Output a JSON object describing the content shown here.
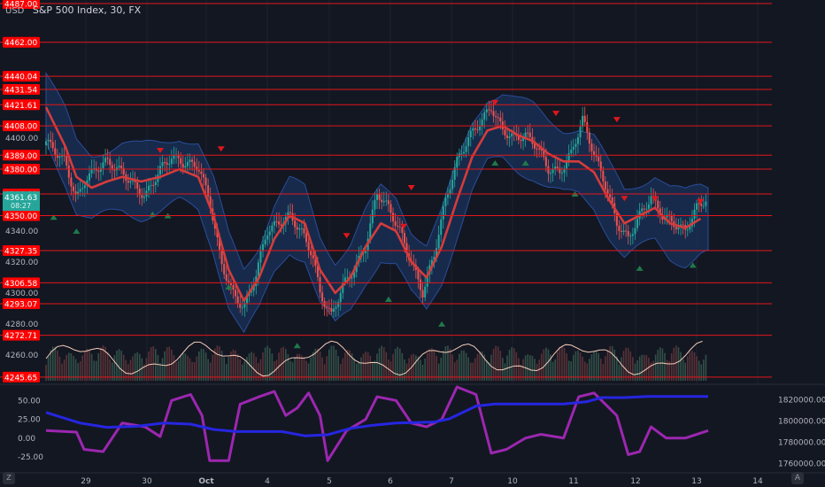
{
  "header": {
    "currency": "USD",
    "title": "S&P 500 Index, 30, FX"
  },
  "badges": {
    "last_price": "4361.63",
    "countdown": "08:27",
    "zoom": "Z",
    "auto": "A"
  },
  "colors": {
    "background": "#131722",
    "level_line": "#e3171b",
    "badge": "#ff0000",
    "last_price_badge": "#26a69a",
    "candle_up": "#26a69a",
    "candle_down": "#ef5350",
    "band_fill": "#1b3a6e",
    "basis_line": "#d43c3c",
    "volume_line": "#f3c9b8",
    "oscillator": "#9c27b0",
    "ad_line": "#2626e0"
  },
  "chart_data": [
    {
      "type": "line",
      "name": "price-panel",
      "x": [
        "29",
        "30",
        "Oct",
        "4",
        "5",
        "6",
        "7",
        "10",
        "11",
        "12",
        "13",
        "14"
      ],
      "ylim": [
        4245,
        4487
      ],
      "y_ticks": [
        4260,
        4280,
        4300,
        4320,
        4340,
        4400,
        4420
      ],
      "y_tick_labels": [
        "4260.00",
        "4280.00",
        "4300.00",
        "4320.00",
        "4340.00",
        "4400.00",
        "4420.00"
      ],
      "levels": [
        4487.0,
        4462.0,
        4440.04,
        4431.54,
        4421.61,
        4408.0,
        4389.0,
        4380.0,
        4364.0,
        4350.0,
        4327.35,
        4306.58,
        4293.07,
        4272.71,
        4245.65
      ],
      "level_labels": [
        "4487.00",
        "4462.00",
        "4440.04",
        "4431.54",
        "4421.61",
        "4408.00",
        "4389.00",
        "4380.00",
        "4364.00",
        "4350.00",
        "4327.35",
        "4306.58",
        "4293.07",
        "4272.71",
        "4245.65"
      ],
      "close_path": [
        [
          0,
          4398
        ],
        [
          0.5,
          4385
        ],
        [
          0.8,
          4360
        ],
        [
          1.0,
          4372
        ],
        [
          1.3,
          4380
        ],
        [
          1.6,
          4385
        ],
        [
          2.0,
          4378
        ],
        [
          2.3,
          4370
        ],
        [
          2.6,
          4362
        ],
        [
          3.0,
          4380
        ],
        [
          3.3,
          4388
        ],
        [
          3.6,
          4384
        ],
        [
          4.0,
          4382
        ],
        [
          4.3,
          4360
        ],
        [
          4.6,
          4320
        ],
        [
          4.9,
          4300
        ],
        [
          5.2,
          4290
        ],
        [
          5.5,
          4310
        ],
        [
          5.8,
          4340
        ],
        [
          6.1,
          4345
        ],
        [
          6.4,
          4350
        ],
        [
          6.7,
          4340
        ],
        [
          7.0,
          4325
        ],
        [
          7.2,
          4300
        ],
        [
          7.5,
          4285
        ],
        [
          7.8,
          4305
        ],
        [
          8.1,
          4315
        ],
        [
          8.4,
          4330
        ],
        [
          8.7,
          4365
        ],
        [
          9.0,
          4355
        ],
        [
          9.3,
          4340
        ],
        [
          9.6,
          4320
        ],
        [
          9.9,
          4300
        ],
        [
          10.2,
          4325
        ],
        [
          10.5,
          4360
        ],
        [
          10.8,
          4385
        ],
        [
          11.1,
          4400
        ],
        [
          11.4,
          4410
        ],
        [
          11.7,
          4420
        ],
        [
          12.0,
          4405
        ],
        [
          12.3,
          4400
        ],
        [
          12.6,
          4402
        ],
        [
          12.9,
          4395
        ],
        [
          13.2,
          4380
        ],
        [
          13.5,
          4378
        ],
        [
          13.8,
          4390
        ],
        [
          14.1,
          4412
        ],
        [
          14.4,
          4390
        ],
        [
          14.7,
          4370
        ],
        [
          15.0,
          4345
        ],
        [
          15.3,
          4335
        ],
        [
          15.6,
          4350
        ],
        [
          15.9,
          4362
        ],
        [
          16.2,
          4350
        ],
        [
          16.5,
          4345
        ],
        [
          16.8,
          4340
        ],
        [
          17.1,
          4355
        ],
        [
          17.4,
          4362
        ]
      ],
      "basis_path": [
        [
          0,
          4420
        ],
        [
          0.5,
          4395
        ],
        [
          0.8,
          4375
        ],
        [
          1.2,
          4368
        ],
        [
          1.6,
          4372
        ],
        [
          2.0,
          4375
        ],
        [
          2.5,
          4372
        ],
        [
          3.0,
          4375
        ],
        [
          3.5,
          4380
        ],
        [
          4.0,
          4375
        ],
        [
          4.4,
          4350
        ],
        [
          4.8,
          4315
        ],
        [
          5.2,
          4295
        ],
        [
          5.6,
          4310
        ],
        [
          6.0,
          4335
        ],
        [
          6.4,
          4350
        ],
        [
          6.8,
          4345
        ],
        [
          7.2,
          4315
        ],
        [
          7.6,
          4300
        ],
        [
          8.0,
          4310
        ],
        [
          8.4,
          4330
        ],
        [
          8.8,
          4345
        ],
        [
          9.2,
          4340
        ],
        [
          9.6,
          4320
        ],
        [
          10.0,
          4310
        ],
        [
          10.4,
          4330
        ],
        [
          10.8,
          4360
        ],
        [
          11.2,
          4388
        ],
        [
          11.6,
          4405
        ],
        [
          12.0,
          4408
        ],
        [
          12.4,
          4402
        ],
        [
          12.8,
          4398
        ],
        [
          13.2,
          4390
        ],
        [
          13.6,
          4385
        ],
        [
          14.0,
          4385
        ],
        [
          14.4,
          4378
        ],
        [
          14.8,
          4360
        ],
        [
          15.2,
          4345
        ],
        [
          15.6,
          4350
        ],
        [
          16.0,
          4355
        ],
        [
          16.4,
          4345
        ],
        [
          16.8,
          4342
        ],
        [
          17.2,
          4348
        ]
      ],
      "band_width": 22
    },
    {
      "type": "line",
      "name": "oscillator-panel",
      "ylim": [
        -45,
        68
      ],
      "y_ticks": [
        50,
        25,
        0,
        -25
      ],
      "y_tick_labels": [
        "50.00",
        "25.00",
        "0.00",
        "-25.00"
      ],
      "right_ylim": [
        1752000,
        1832000
      ],
      "right_ticks": [
        1820000,
        1800000,
        1780000,
        1760000
      ],
      "right_tick_labels": [
        "1820000.00",
        "1800000.00",
        "1780000.00",
        "1760000.00"
      ],
      "series": [
        {
          "points": [
            [
              0,
              10
            ],
            [
              0.8,
              8
            ],
            [
              1.0,
              -15
            ],
            [
              1.5,
              -18
            ],
            [
              2.0,
              20
            ],
            [
              2.6,
              15
            ],
            [
              3.0,
              2
            ],
            [
              3.3,
              50
            ],
            [
              3.8,
              58
            ],
            [
              4.1,
              30
            ],
            [
              4.3,
              -30
            ],
            [
              4.8,
              -30
            ],
            [
              5.1,
              45
            ],
            [
              5.6,
              55
            ],
            [
              6.0,
              62
            ],
            [
              6.3,
              30
            ],
            [
              6.6,
              40
            ],
            [
              6.9,
              60
            ],
            [
              7.2,
              30
            ],
            [
              7.4,
              -30
            ],
            [
              7.9,
              10
            ],
            [
              8.4,
              25
            ],
            [
              8.7,
              55
            ],
            [
              9.2,
              50
            ],
            [
              9.6,
              20
            ],
            [
              10.0,
              15
            ],
            [
              10.4,
              25
            ],
            [
              10.8,
              68
            ],
            [
              11.3,
              58
            ],
            [
              11.7,
              -20
            ],
            [
              12.1,
              -15
            ],
            [
              12.6,
              0
            ],
            [
              13.0,
              5
            ],
            [
              13.6,
              0
            ],
            [
              14.0,
              55
            ],
            [
              14.4,
              60
            ],
            [
              15.0,
              30
            ],
            [
              15.3,
              -22
            ],
            [
              15.6,
              -18
            ],
            [
              15.9,
              15
            ],
            [
              16.3,
              0
            ],
            [
              16.8,
              0
            ],
            [
              17.4,
              10
            ]
          ]
        },
        {
          "points": [
            [
              0,
              1808000
            ],
            [
              0.9,
              1798000
            ],
            [
              1.6,
              1794000
            ],
            [
              2.4,
              1795000
            ],
            [
              3.1,
              1798000
            ],
            [
              3.8,
              1797000
            ],
            [
              4.4,
              1792000
            ],
            [
              5.0,
              1790000
            ],
            [
              5.6,
              1790000
            ],
            [
              6.2,
              1790000
            ],
            [
              6.8,
              1786000
            ],
            [
              7.4,
              1787000
            ],
            [
              8.0,
              1793000
            ],
            [
              8.6,
              1796000
            ],
            [
              9.2,
              1798000
            ],
            [
              10.2,
              1799000
            ],
            [
              10.6,
              1802000
            ],
            [
              11.3,
              1814000
            ],
            [
              11.8,
              1816000
            ],
            [
              12.6,
              1816000
            ],
            [
              13.6,
              1816000
            ],
            [
              14.2,
              1818000
            ],
            [
              14.6,
              1822000
            ],
            [
              15.2,
              1822000
            ],
            [
              15.8,
              1823000
            ],
            [
              17.4,
              1823000
            ]
          ]
        }
      ]
    }
  ]
}
